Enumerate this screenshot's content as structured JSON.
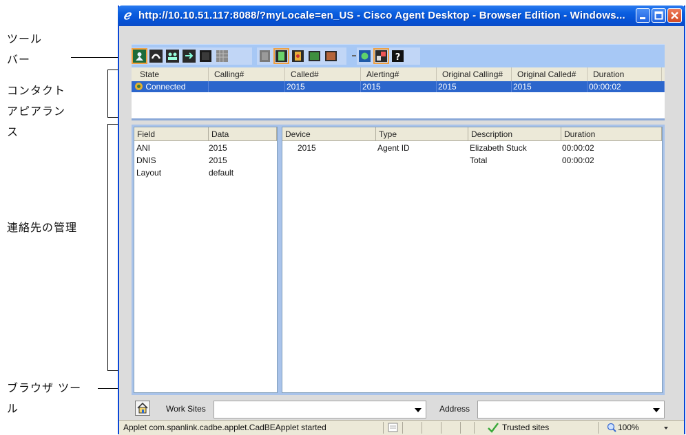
{
  "annotations": {
    "toolbar": "ツール\nバー",
    "contact_appearance": "コンタクト\nアピアラン\nス",
    "contact_management": "連絡先の管理",
    "browser_tools": "ブラウザ ツー\nル"
  },
  "window": {
    "title": "http://10.10.51.117:8088/?myLocale=en_US - Cisco Agent Desktop - Browser Edition - Windows..."
  },
  "contact_table": {
    "columns": [
      "State",
      "Calling#",
      "Called#",
      "Alerting#",
      "Original Calling#",
      "Original Called#",
      "Duration"
    ],
    "row": {
      "state": "Connected",
      "calling": "",
      "called": "2015",
      "alerting": "2015",
      "original_calling": "2015",
      "original_called": "2015",
      "duration": "00:00:02"
    }
  },
  "enterprise_data": {
    "columns": [
      "Field",
      "Data"
    ],
    "rows": [
      {
        "field": "ANI",
        "data": "2015"
      },
      {
        "field": "DNIS",
        "data": "2015"
      },
      {
        "field": "Layout",
        "data": "default"
      }
    ]
  },
  "call_activity": {
    "columns": [
      "Device",
      "Type",
      "Description",
      "Duration"
    ],
    "rows": [
      {
        "device": "2015",
        "type": "Agent ID",
        "description": "Elizabeth Stuck",
        "duration": "00:00:02"
      },
      {
        "device": "",
        "type": "",
        "description": "Total",
        "duration": "00:00:02"
      }
    ]
  },
  "browser_tools": {
    "work_sites_label": "Work Sites",
    "work_sites_value": "",
    "address_label": "Address",
    "address_value": ""
  },
  "statusbar": {
    "message": "Applet com.spanlink.cadbe.applet.CadBEApplet started",
    "zone": "Trusted sites",
    "zoom": "100%"
  },
  "colors": {
    "titlebar": "#0b5fe0",
    "toolbar": "#a7c8f5",
    "selected_row": "#2c66cc",
    "management_frame": "#a9c3ea"
  },
  "icons": {
    "toolbar": [
      "agent-state-icon",
      "answer-icon",
      "conference-icon",
      "transfer-icon",
      "hold-icon",
      "keypad-icon",
      "ready-icon",
      "not-ready-icon",
      "work-icon",
      "logout-icon",
      "record-icon",
      "chat-icon",
      "supervisor-icon",
      "help-icon"
    ]
  }
}
